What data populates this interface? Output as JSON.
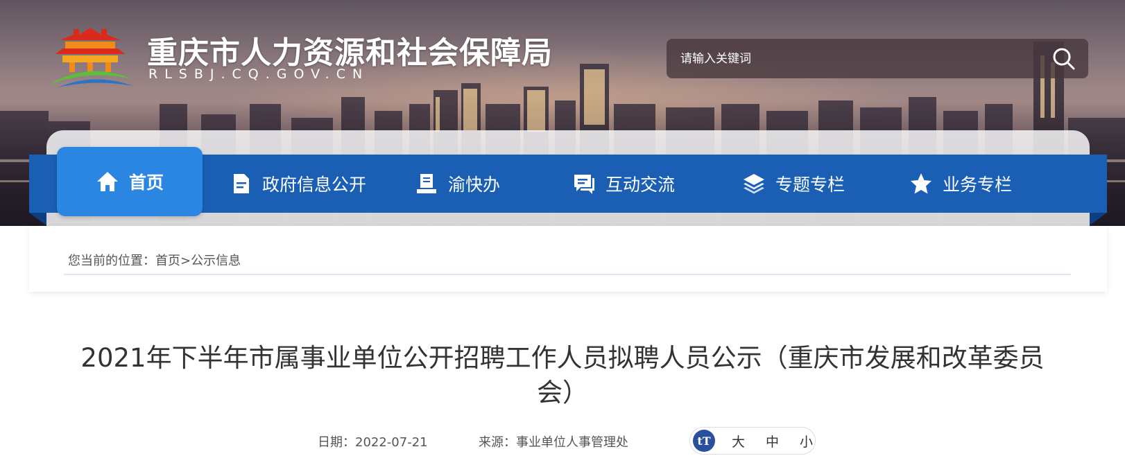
{
  "header": {
    "site_title": "重庆市人力资源和社会保障局",
    "site_domain": "RLSBJ.CQ.GOV.CN",
    "logo_icon": "temple-of-heaven-logo-icon",
    "colors": {
      "nav_bar": "#1a5fb4",
      "nav_active": "#2a86e0",
      "logo_orange": "#f08a1a",
      "logo_red": "#d92a1c",
      "logo_green": "#5bbf3a",
      "logo_blue": "#2a74c8"
    }
  },
  "search": {
    "placeholder": "请输入关键词",
    "icon": "search-icon"
  },
  "nav": {
    "items": [
      {
        "label": "首页",
        "icon": "home-icon",
        "active": true
      },
      {
        "label": "政府信息公开",
        "icon": "document-icon",
        "active": false
      },
      {
        "label": "渝快办",
        "icon": "desk-service-icon",
        "active": false
      },
      {
        "label": "互动交流",
        "icon": "chat-icon",
        "active": false
      },
      {
        "label": "专题专栏",
        "icon": "layers-icon",
        "active": false
      },
      {
        "label": "业务专栏",
        "icon": "star-icon",
        "active": false
      }
    ]
  },
  "breadcrumb": {
    "prefix": "您当前的位置：",
    "home": "首页",
    "separator": ">",
    "current": "公示信息"
  },
  "article": {
    "title": "2021年下半年市属事业单位公开招聘工作人员拟聘人员公示（重庆市发展和改革委员会）",
    "date_label": "日期：",
    "date": "2022-07-21",
    "source_label": "来源：",
    "source": "事业单位人事管理处",
    "font_size": {
      "icon_text": "tT",
      "large": "大",
      "medium": "中",
      "small": "小"
    }
  }
}
